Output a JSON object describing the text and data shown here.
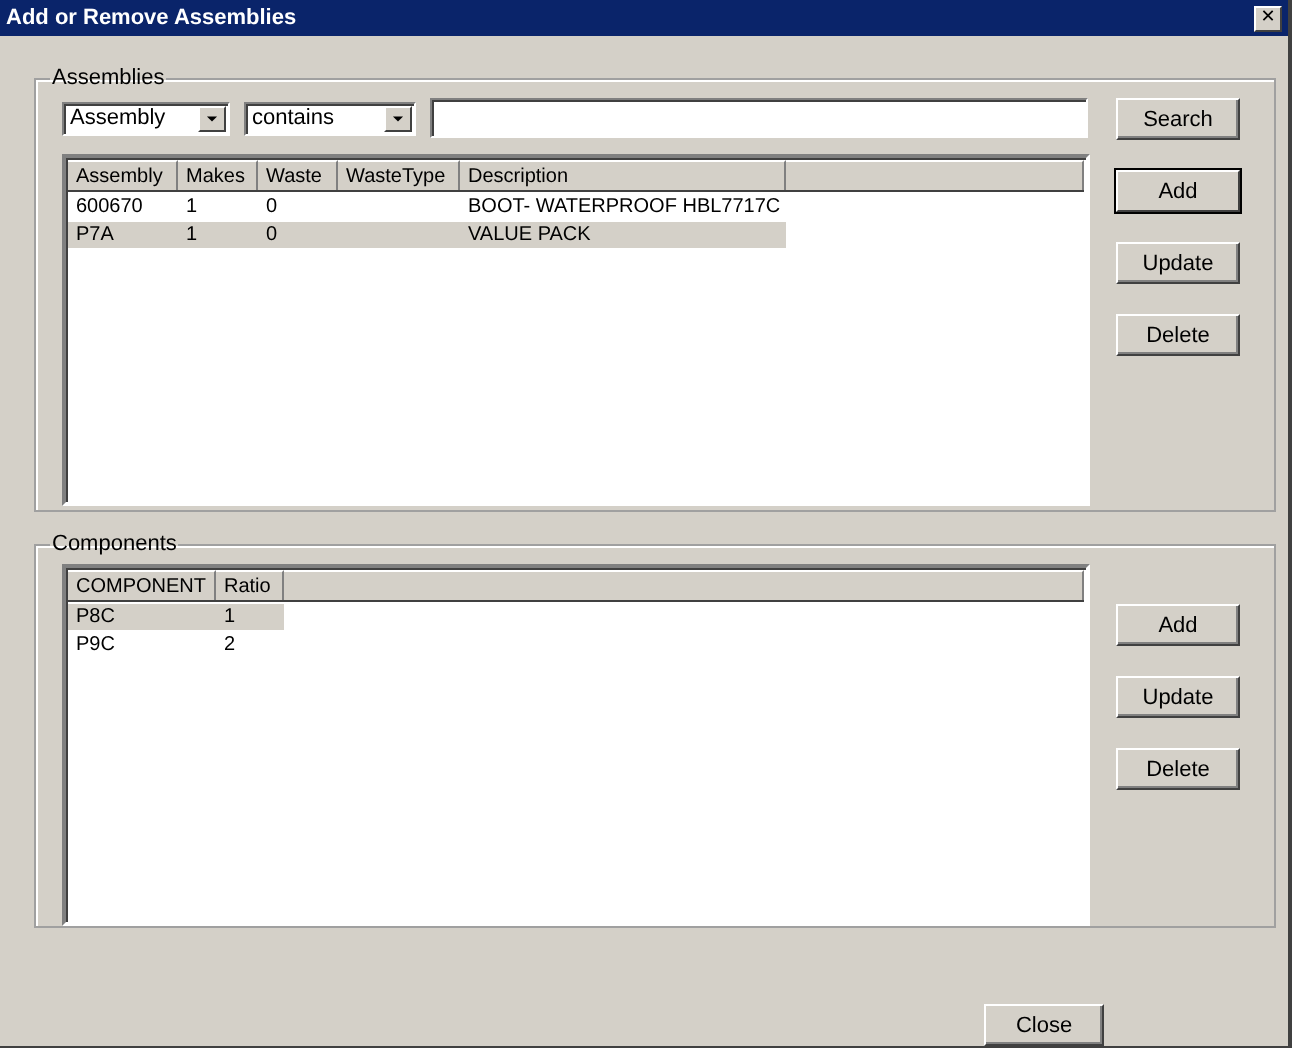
{
  "window": {
    "title": "Add or Remove Assemblies",
    "close_glyph": "✕"
  },
  "assemblies": {
    "legend": "Assemblies",
    "field_select": {
      "value": "Assembly"
    },
    "operator_select": {
      "value": "contains"
    },
    "search_button": "Search",
    "columns": [
      "Assembly",
      "Makes",
      "Waste",
      "WasteType",
      "Description"
    ],
    "rows": [
      {
        "cells": [
          "600670",
          "1",
          "0",
          "",
          "BOOT- WATERPROOF HBL7717C"
        ],
        "selected": false
      },
      {
        "cells": [
          "P7A",
          "1",
          "0",
          "",
          "VALUE PACK"
        ],
        "selected": true
      }
    ],
    "buttons": [
      {
        "label": "Add",
        "default": true
      },
      {
        "label": "Update",
        "default": false
      },
      {
        "label": "Delete",
        "default": false
      }
    ]
  },
  "components": {
    "legend": "Components",
    "columns": [
      "COMPONENT",
      "Ratio"
    ],
    "rows": [
      {
        "cells": [
          "P8C",
          "1"
        ],
        "selected": true
      },
      {
        "cells": [
          "P9C",
          "2"
        ],
        "selected": false
      }
    ],
    "buttons": [
      {
        "label": "Add",
        "default": false
      },
      {
        "label": "Update",
        "default": false
      },
      {
        "label": "Delete",
        "default": false
      }
    ]
  },
  "close_button": "Close"
}
